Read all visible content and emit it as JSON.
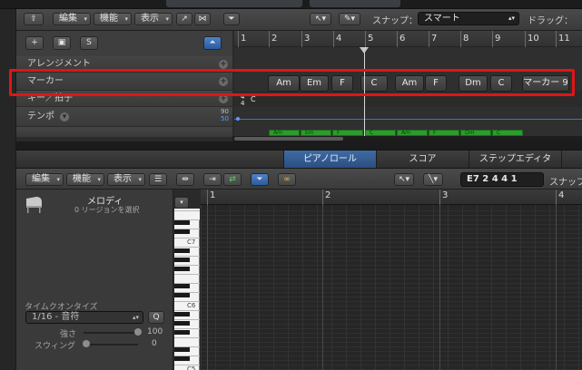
{
  "main_toolbar": {
    "edit_menu": "編集",
    "function_menu": "機能",
    "view_menu": "表示",
    "snap_label": "スナップ：",
    "snap_value": "スマート",
    "drag_label": "ドラッグ："
  },
  "track_headers": {
    "arrangement": "アレンジメント",
    "marker": "マーカー",
    "key_signature": "キー／拍子",
    "tempo": "テンポ",
    "tempo_high": "90",
    "tempo_low": "50",
    "add_button": "+",
    "s_button": "S"
  },
  "ruler_bars": [
    "1",
    "2",
    "3",
    "4",
    "5",
    "6",
    "7",
    "8",
    "9",
    "10",
    "11"
  ],
  "markers": [
    "Am",
    "Em",
    "F",
    "C",
    "Am",
    "F",
    "Dm",
    "C",
    "マーカー 9"
  ],
  "key_lane": {
    "key": "C",
    "sig_top": "4",
    "sig_bottom": "4"
  },
  "regions": [
    "Am",
    "Em",
    "F",
    "C",
    "Am",
    "F",
    "Dm",
    "C"
  ],
  "editor_tabs": [
    "ピアノロール",
    "スコア",
    "ステップエディタ"
  ],
  "editor_toolbar": {
    "edit_menu": "編集",
    "function_menu": "機能",
    "view_menu": "表示",
    "position": "E7  2 4 4 1",
    "snap_label": "スナップ"
  },
  "inspector": {
    "region_name": "メロディ",
    "region_sub": "0 リージョンを選択",
    "quantize_title": "タイムクオンタイズ",
    "quantize_value": "1/16 - 音符",
    "strength_label": "強さ",
    "strength_value": "100",
    "swing_label": "スウィング",
    "swing_value": "0"
  },
  "piano_octaves": [
    "C7",
    "C6",
    "C5"
  ],
  "editor_ruler": [
    "1",
    "2",
    "3",
    "4"
  ],
  "colors": {
    "highlight": "#e01515",
    "active_tab": "#3f6ba3",
    "region_green": "#2e9b2e"
  }
}
